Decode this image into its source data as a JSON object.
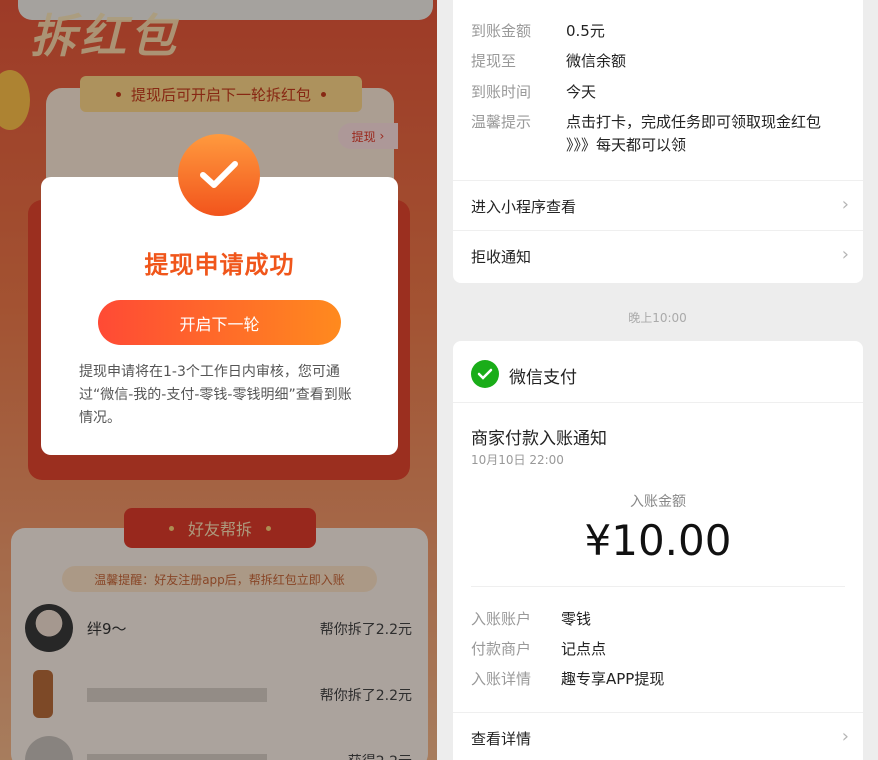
{
  "left": {
    "banner_title": "拆红包",
    "ribbon": "提现后可开启下一轮拆红包",
    "tixian_pill": "提现",
    "modal": {
      "title": "提现申请成功",
      "button": "开启下一轮",
      "desc": "提现申请将在1-3个工作日内审核，您可通过“微信-我的-支付-零钱-零钱明细”查看到账情况。"
    },
    "friends_tab": "好友帮拆",
    "tip": "温馨提醒：好友注册app后，帮拆红包立即入账",
    "friends": [
      {
        "name": "绊9～",
        "help": "帮你拆了2.2元"
      },
      {
        "name": "",
        "help": "帮你拆了2.2元"
      },
      {
        "name": "",
        "help": "获得2.2元"
      }
    ]
  },
  "right": {
    "card1": {
      "rows": [
        {
          "k": "到账金额",
          "v": "0.5元"
        },
        {
          "k": "提现至",
          "v": "微信余额"
        },
        {
          "k": "到账时间",
          "v": "今天"
        },
        {
          "k": "温馨提示",
          "v": "点击打卡，完成任务即可领取现金红包 》》》每天都可以领"
        }
      ],
      "links": [
        "进入小程序查看",
        "拒收通知"
      ]
    },
    "time_sep": "晚上10:00",
    "card2": {
      "app_name": "微信支付",
      "title": "商家付款入账通知",
      "date": "10月10日  22:00",
      "amount_label": "入账金额",
      "amount": "¥10.00",
      "rows": [
        {
          "k": "入账账户",
          "v": "零钱"
        },
        {
          "k": "付款商户",
          "v": "记点点"
        },
        {
          "k": "入账详情",
          "v": "趣专享APP提现"
        }
      ],
      "link": "查看详情"
    }
  },
  "colors": {
    "accent": "#f0561b",
    "wechat_green": "#1aad19"
  }
}
